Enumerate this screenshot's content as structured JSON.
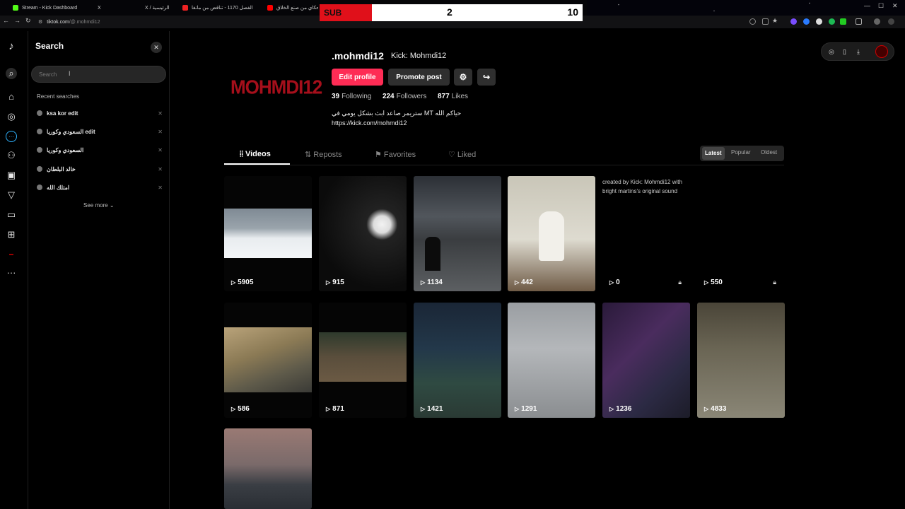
{
  "browser": {
    "tabs": [
      "Stream - Kick Dashboard",
      "X",
      "X / الرئيسية",
      "الفصل 1170 - تناقض من مانغا",
      "حكاي من صنع الخلاق"
    ],
    "url_host": "tiktok.com",
    "url_path": "/@.mohmdi12"
  },
  "scoreboard": {
    "label": "SUB",
    "left_value": "2",
    "right_value": "10"
  },
  "search_panel": {
    "title": "Search",
    "placeholder": "Search",
    "recent_title": "Recent searches",
    "recent": [
      "ksa kor edit",
      "السعودي وكوريا edit",
      "السعودي وكوريا",
      "خالد البلطان",
      "امتلك الله"
    ],
    "see_more": "See more"
  },
  "profile": {
    "logo_text": "MOHMDI12",
    "username": ".mohmdi12",
    "nickname": "Kick: Mohmdi12",
    "edit_profile": "Edit profile",
    "promote_post": "Promote post",
    "following": "39",
    "following_label": "Following",
    "followers": "224",
    "followers_label": "Followers",
    "likes": "877",
    "likes_label": "Likes",
    "bio_line1": "حياكم الله MT ستريمر صاعد ابث بشكل يومي في",
    "bio_line2": "https://kick.com/mohmdi12"
  },
  "tabs": [
    "Videos",
    "Reposts",
    "Favorites",
    "Liked"
  ],
  "sort": [
    "Latest",
    "Popular",
    "Oldest"
  ],
  "videos": [
    {
      "views": "5905",
      "locked": false
    },
    {
      "views": "915",
      "locked": false
    },
    {
      "views": "1134",
      "locked": false
    },
    {
      "views": "442",
      "locked": false
    },
    {
      "views": "0",
      "locked": true,
      "alt": "created by Kick: Mohmdi12 with bright martins's original sound"
    },
    {
      "views": "550",
      "locked": true
    },
    {
      "views": "586",
      "locked": false
    },
    {
      "views": "871",
      "locked": false
    },
    {
      "views": "1421",
      "locked": false
    },
    {
      "views": "1291",
      "locked": false
    },
    {
      "views": "1236",
      "locked": false
    },
    {
      "views": "4833",
      "locked": false
    },
    {
      "views": "",
      "locked": false
    }
  ],
  "colors": {
    "accent": "#fe2c55",
    "score_red": "#e0101a",
    "logo_red": "#a50f1b"
  }
}
